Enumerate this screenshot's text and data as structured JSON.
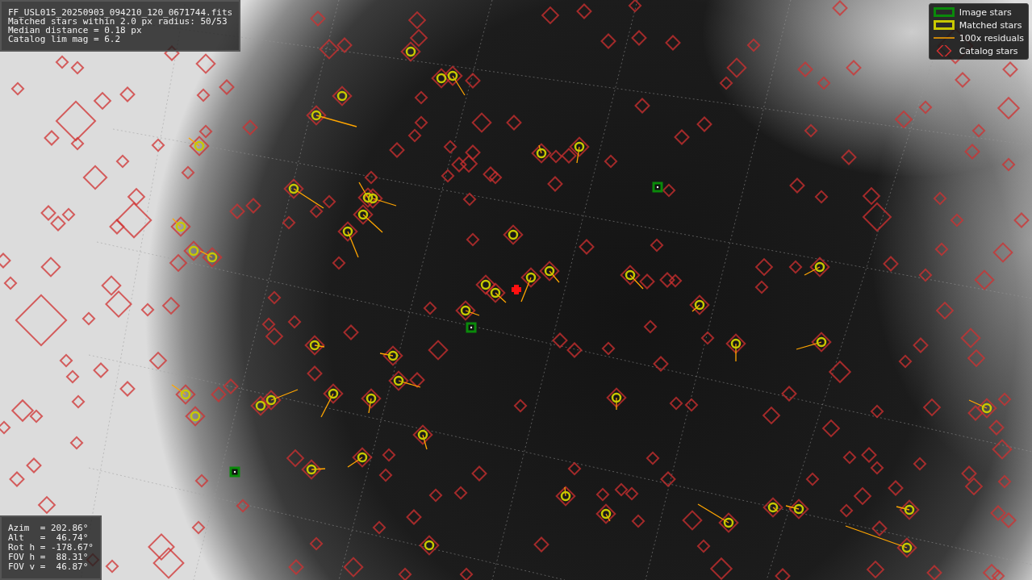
{
  "info_panel": {
    "lines": [
      "FF_USL015_20250903_094210_120_0671744.fits",
      "Matched stars within 2.0 px radius: 50/53",
      "Median distance = 0.18 px",
      "Catalog lim mag = 6.2"
    ]
  },
  "legend": {
    "items": [
      {
        "kind": "image",
        "label": "Image stars"
      },
      {
        "kind": "matched",
        "label": "Matched stars"
      },
      {
        "kind": "residual",
        "label": "100x residuals"
      },
      {
        "kind": "catalog",
        "label": "Catalog stars"
      }
    ]
  },
  "pointing_panel": {
    "lines": [
      "Azim  = 202.86°",
      "Alt   =  46.74°",
      "Rot h = -178.67°",
      "FOV h =  88.31°",
      "FOV v =  46.87°"
    ]
  }
}
